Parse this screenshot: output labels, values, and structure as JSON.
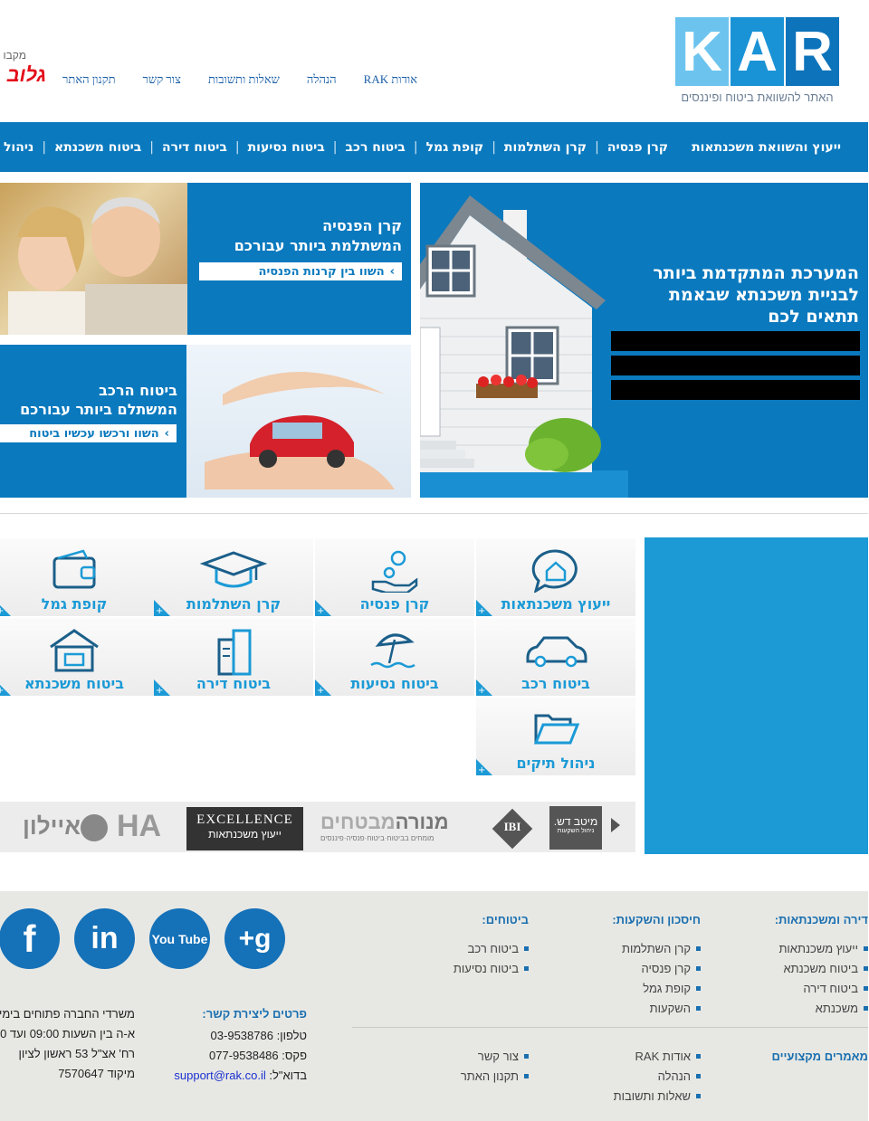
{
  "header": {
    "logo_letters": [
      "R",
      "A",
      "K"
    ],
    "tagline": "האתר להשוואת ביטוח ופיננסים",
    "top_links": [
      "אודות RAK",
      "הנהלה",
      "שאלות ותשובות",
      "צור קשר",
      "תקנון האתר"
    ],
    "sponsor_label": "מקבו",
    "sponsor_logo": "גלוב"
  },
  "nav": {
    "items": [
      "ייעוץ והשוואת משכנתאות",
      "קרן פנסיה",
      "קרן השתלמות",
      "קופת גמל",
      "ביטוח רכב",
      "ביטוח נסיעות",
      "ביטוח דירה",
      "ביטוח משכנתא",
      "ניהול תיקים"
    ]
  },
  "hero": {
    "mortgage": {
      "line1": "המערכת המתקדמת ביותר",
      "line2": "לבניית משכנתא שבאמת",
      "line3": "תתאים לכם"
    },
    "pension": {
      "line1": "קרן הפנסיה",
      "line2": "המשתלמת ביותר עבורכם",
      "cta": "השוו בין קרנות הפנסיה"
    },
    "car": {
      "line1": "ביטוח הרכב",
      "line2": "המשתלם ביותר עבורכם",
      "cta": "השוו ורכשו עכשיו ביטוח"
    }
  },
  "services": [
    {
      "label": "ייעוץ משכנתאות",
      "icon": "home-chat-icon"
    },
    {
      "label": "קרן פנסיה",
      "icon": "coin-hand-icon"
    },
    {
      "label": "קרן השתלמות",
      "icon": "graduation-cap-icon"
    },
    {
      "label": "קופת גמל",
      "icon": "wallet-icon"
    },
    {
      "label": "ביטוח רכב",
      "icon": "car-icon"
    },
    {
      "label": "ביטוח נסיעות",
      "icon": "beach-umbrella-icon"
    },
    {
      "label": "ביטוח דירה",
      "icon": "building-icon"
    },
    {
      "label": "ביטוח משכנתא",
      "icon": "house-icon"
    },
    {
      "label": "ניהול תיקים",
      "icon": "folder-icon"
    }
  ],
  "partners": {
    "meitav_1": "מיטב דש.",
    "meitav_2": "ניהול השקעות",
    "ibi": "IBI",
    "menora_1": "מנורה",
    "menora_2": "מבטחים",
    "menora_3": "מומחים בביטוח·ביטוח·פנסיה·פיננסים",
    "excellence_1": "EXCELLENCE",
    "excellence_2": "ייעוץ משכנתאות",
    "ha": "HA",
    "ayalon": "איילון"
  },
  "footer": {
    "col_apartment": {
      "title": "דירה ומשכנתאות:",
      "items": [
        "ייעוץ משכנתאות",
        "ביטוח משכנתא",
        "ביטוח דירה",
        "משכנתא"
      ]
    },
    "col_savings": {
      "title": "חיסכון והשקעות:",
      "items": [
        "קרן השתלמות",
        "קרן פנסיה",
        "קופת גמל",
        "השקעות"
      ]
    },
    "col_insurance": {
      "title": "ביטוחים:",
      "items": [
        "ביטוח רכב",
        "ביטוח נסיעות"
      ]
    },
    "articles": "מאמרים מקצועיים",
    "links_a": [
      "אודות RAK",
      "הנהלה",
      "שאלות ותשובות"
    ],
    "links_b": [
      "צור קשר",
      "תקנון האתר"
    ],
    "contact": {
      "title": "פרטים ליצירת קשר:",
      "phone_label": "טלפון:",
      "phone": "03-9538786",
      "fax_label": "פקס:",
      "fax": "077-9538486",
      "email_label": "בדוא\"ל:",
      "email": "support@rak.co.il"
    },
    "office": [
      "משרדי החברה פתוחים בימי",
      "א-ה בין השעות 09:00 ועד 0",
      "רח' אצ\"ל 53 ראשון לציון",
      "מיקוד 7570647"
    ],
    "social": [
      {
        "name": "google-plus-icon",
        "glyph": "g+"
      },
      {
        "name": "youtube-icon",
        "glyph": "You Tube"
      },
      {
        "name": "linkedin-icon",
        "glyph": "in"
      },
      {
        "name": "facebook-icon",
        "glyph": "f"
      }
    ]
  },
  "colors": {
    "brand_blue": "#0a79be",
    "logo_dark": "#0d73bb",
    "logo_mid": "#1a93d6",
    "logo_light": "#6cc4ee",
    "accent_text": "#1b9ad6"
  }
}
